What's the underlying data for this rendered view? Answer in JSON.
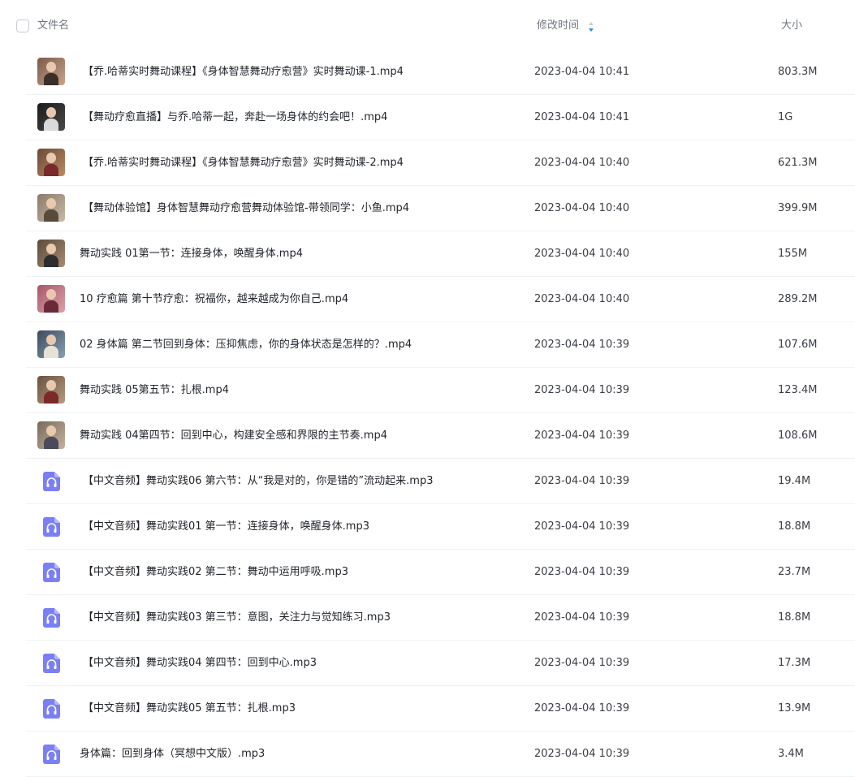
{
  "header": {
    "name_label": "文件名",
    "time_label": "修改时间",
    "size_label": "大小",
    "sort_icon": "sort-arrows-icon"
  },
  "colors": {
    "accent": "#1e90ff",
    "audio_icon": "#7b7ff5",
    "separator": "#f1f2f4"
  },
  "files": [
    {
      "name": "【乔.哈蒂实时舞动课程】《身体智慧舞动疗愈营》实时舞动课-1.mp4",
      "time": "2023-04-04 10:41",
      "size": "803.3M",
      "type": "video"
    },
    {
      "name": "【舞动疗愈直播】与乔.哈蒂一起，奔赴一场身体的约会吧！.mp4",
      "time": "2023-04-04 10:41",
      "size": "1G",
      "type": "video"
    },
    {
      "name": "【乔.哈蒂实时舞动课程】《身体智慧舞动疗愈营》实时舞动课-2.mp4",
      "time": "2023-04-04 10:40",
      "size": "621.3M",
      "type": "video"
    },
    {
      "name": "【舞动体验馆】身体智慧舞动疗愈营舞动体验馆-带领同学：小鱼.mp4",
      "time": "2023-04-04 10:40",
      "size": "399.9M",
      "type": "video"
    },
    {
      "name": "舞动实践 01第一节：连接身体，唤醒身体.mp4",
      "time": "2023-04-04 10:40",
      "size": "155M",
      "type": "video"
    },
    {
      "name": "10 疗愈篇 第十节疗愈：祝福你，越来越成为你自己.mp4",
      "time": "2023-04-04 10:40",
      "size": "289.2M",
      "type": "video"
    },
    {
      "name": "02 身体篇 第二节回到身体：压抑焦虑，你的身体状态是怎样的？.mp4",
      "time": "2023-04-04 10:39",
      "size": "107.6M",
      "type": "video"
    },
    {
      "name": "舞动实践 05第五节：扎根.mp4",
      "time": "2023-04-04 10:39",
      "size": "123.4M",
      "type": "video"
    },
    {
      "name": "舞动实践 04第四节：回到中心，构建安全感和界限的主节奏.mp4",
      "time": "2023-04-04 10:39",
      "size": "108.6M",
      "type": "video"
    },
    {
      "name": "【中文音频】舞动实践06 第六节：从“我是对的，你是错的”流动起来.mp3",
      "time": "2023-04-04 10:39",
      "size": "19.4M",
      "type": "audio"
    },
    {
      "name": "【中文音频】舞动实践01 第一节：连接身体，唤醒身体.mp3",
      "time": "2023-04-04 10:39",
      "size": "18.8M",
      "type": "audio"
    },
    {
      "name": "【中文音频】舞动实践02 第二节：舞动中运用呼吸.mp3",
      "time": "2023-04-04 10:39",
      "size": "23.7M",
      "type": "audio"
    },
    {
      "name": "【中文音频】舞动实践03 第三节：意图，关注力与觉知练习.mp3",
      "time": "2023-04-04 10:39",
      "size": "18.8M",
      "type": "audio"
    },
    {
      "name": "【中文音频】舞动实践04 第四节：回到中心.mp3",
      "time": "2023-04-04 10:39",
      "size": "17.3M",
      "type": "audio"
    },
    {
      "name": "【中文音频】舞动实践05 第五节：扎根.mp3",
      "time": "2023-04-04 10:39",
      "size": "13.9M",
      "type": "audio"
    },
    {
      "name": "身体篇：回到身体（冥想中文版）.mp3",
      "time": "2023-04-04 10:39",
      "size": "3.4M",
      "type": "audio"
    }
  ]
}
